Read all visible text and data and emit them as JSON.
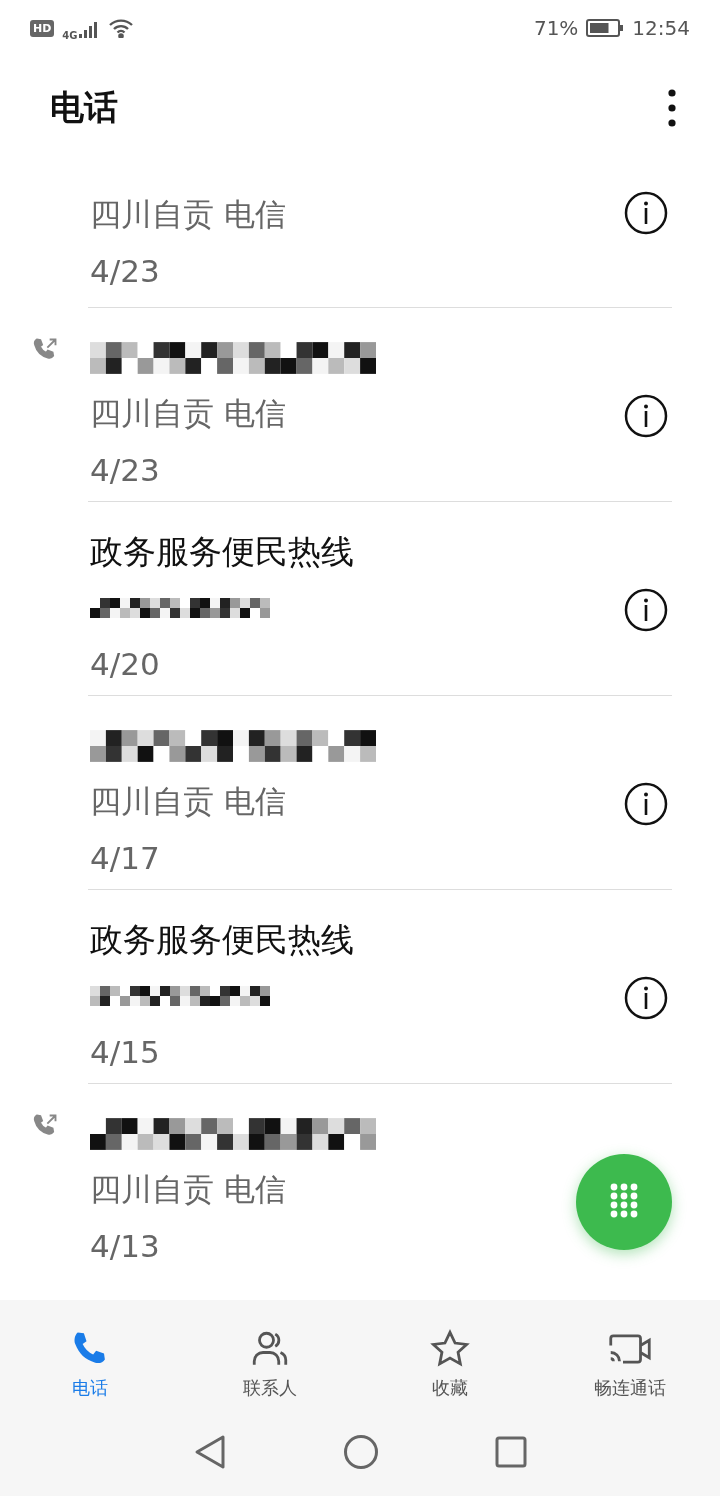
{
  "status_bar": {
    "hd": "HD",
    "network": "4G",
    "battery_text": "71%",
    "time": "12:54"
  },
  "header": {
    "title": "电话"
  },
  "calls": [
    {
      "kind": "cut_off",
      "outgoing": false,
      "subtitle": "四川自贡 电信",
      "date": "4/23"
    },
    {
      "kind": "hidden_number",
      "outgoing": true,
      "subtitle": "四川自贡 电信",
      "date": "4/23"
    },
    {
      "kind": "named",
      "outgoing": false,
      "title": "政务服务便民热线",
      "date": "4/20"
    },
    {
      "kind": "hidden_number",
      "outgoing": false,
      "subtitle": "四川自贡 电信",
      "date": "4/17"
    },
    {
      "kind": "named",
      "outgoing": false,
      "title": "政务服务便民热线",
      "date": "4/15"
    },
    {
      "kind": "hidden_number",
      "outgoing": true,
      "subtitle": "四川自贡 电信",
      "date": "4/13"
    }
  ],
  "tabs": [
    {
      "label": "电话",
      "selected": true
    },
    {
      "label": "联系人",
      "selected": false
    },
    {
      "label": "收藏",
      "selected": false
    },
    {
      "label": "畅连通话",
      "selected": false
    }
  ]
}
